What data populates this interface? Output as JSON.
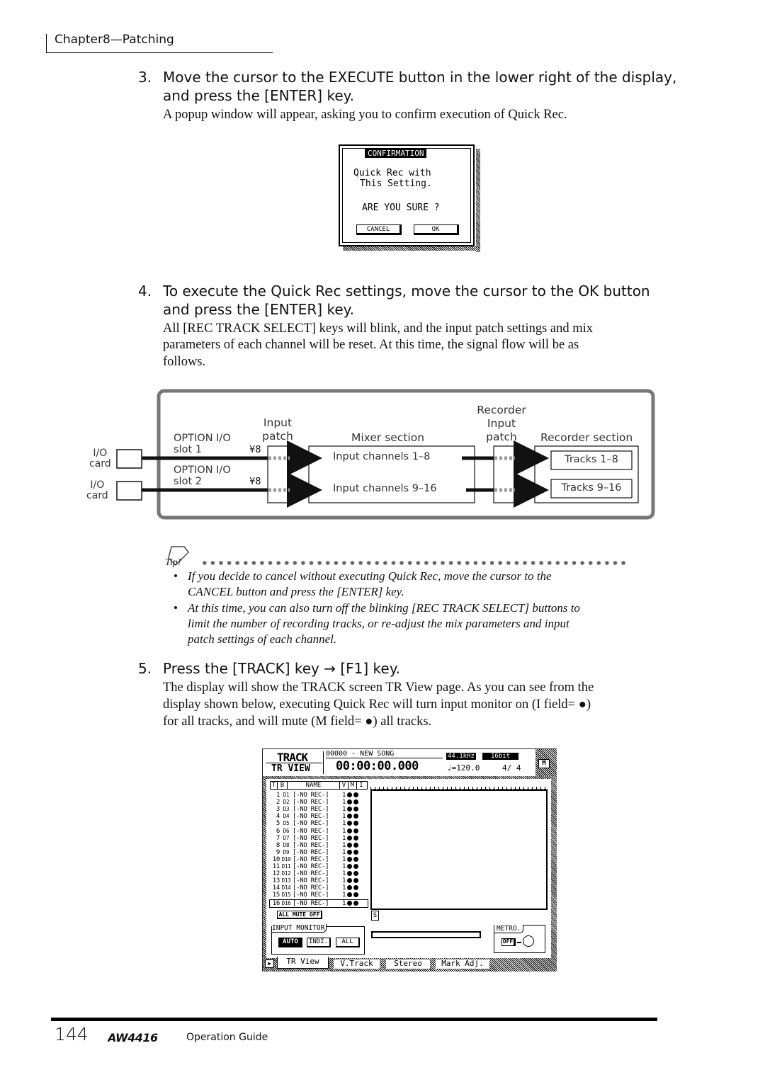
{
  "header": {
    "chapter": "Chapter8—Patching"
  },
  "step3": {
    "num": "3.",
    "line1": "Move the cursor to the EXECUTE button in the lower right of the display,",
    "line2": "and press the [ENTER] key.",
    "body": "A popup window will appear, asking you to confirm execution of Quick Rec."
  },
  "confirm": {
    "title": "CONFIRMATION",
    "line1": "Quick Rec with",
    "line2": "This Setting.",
    "question": "ARE YOU SURE ?",
    "cancel": "CANCEL",
    "ok": "OK"
  },
  "step4": {
    "num": "4.",
    "line1": "To execute the Quick Rec settings, move the cursor to the OK button",
    "line2": "and press the [ENTER] key.",
    "body": [
      "All [REC TRACK SELECT] keys will blink, and the input patch settings and mix",
      "parameters of each channel will be reset. At this time, the signal flow will be as",
      "follows."
    ]
  },
  "diagram": {
    "io_card": [
      "I/O",
      "card"
    ],
    "slot1": [
      "OPTION I/O",
      "slot 1"
    ],
    "slot2": [
      "OPTION I/O",
      "slot 2"
    ],
    "mult": "¥8",
    "input_patch": [
      "Input",
      "patch"
    ],
    "mixer": "Mixer section",
    "ch1": "Input channels 1–8",
    "ch2": "Input channels 9–16",
    "rec_patch": [
      "Recorder",
      "Input",
      "patch"
    ],
    "recorder": "Recorder section",
    "tr1": "Tracks 1–8",
    "tr2": "Tracks 9–16"
  },
  "tip": {
    "label": "Tip!",
    "bullets": [
      [
        "If you decide to cancel without executing Quick Rec, move the cursor to the",
        "CANCEL button and press the [ENTER] key."
      ],
      [
        "At this time, you can also turn off the blinking [REC TRACK SELECT] buttons to",
        "limit the number of recording tracks, or re-adjust the mix parameters and input",
        "patch settings of each channel."
      ]
    ]
  },
  "step5": {
    "num": "5.",
    "line1": "Press the [TRACK] key → [F1] key.",
    "body": [
      "The display will show the TRACK screen TR View page. As you can see from the",
      "display shown below, executing Quick Rec will turn input monitor on (I field= ●)",
      "for all tracks, and will mute (M field= ●) all tracks."
    ]
  },
  "track_screen": {
    "title": "TRACK",
    "page": "TR VIEW",
    "song": "00000 - NEW SONG",
    "rate": "44.1kHz",
    "bits": "16bit",
    "time": "00:00:00.000",
    "tempo": "♩=120.0",
    "meter": "4/ 4",
    "m_button": "M",
    "columns": [
      "T",
      "B",
      "NAME",
      "V",
      "M",
      "I"
    ],
    "tracks": [
      {
        "t": "1",
        "b": "D1",
        "name": "[-NO REC-]",
        "v": "1"
      },
      {
        "t": "2",
        "b": "D2",
        "name": "[-NO REC-]",
        "v": "1"
      },
      {
        "t": "3",
        "b": "D3",
        "name": "[-NO REC-]",
        "v": "1"
      },
      {
        "t": "4",
        "b": "D4",
        "name": "[-NO REC-]",
        "v": "1"
      },
      {
        "t": "5",
        "b": "D5",
        "name": "[-NO REC-]",
        "v": "1"
      },
      {
        "t": "6",
        "b": "D6",
        "name": "[-NO REC-]",
        "v": "1"
      },
      {
        "t": "7",
        "b": "D7",
        "name": "[-NO REC-]",
        "v": "1"
      },
      {
        "t": "8",
        "b": "D8",
        "name": "[-NO REC-]",
        "v": "1"
      },
      {
        "t": "9",
        "b": "D9",
        "name": "[-NO REC-]",
        "v": "1"
      },
      {
        "t": "10",
        "b": "D10",
        "name": "[-NO REC-]",
        "v": "1"
      },
      {
        "t": "11",
        "b": "D11",
        "name": "[-NO REC-]",
        "v": "1"
      },
      {
        "t": "12",
        "b": "D12",
        "name": "[-NO REC-]",
        "v": "1"
      },
      {
        "t": "13",
        "b": "D13",
        "name": "[-NO REC-]",
        "v": "1"
      },
      {
        "t": "14",
        "b": "D14",
        "name": "[-NO REC-]",
        "v": "1"
      },
      {
        "t": "15",
        "b": "D15",
        "name": "[-NO REC-]",
        "v": "1"
      },
      {
        "t": "16",
        "b": "D16",
        "name": "[-NO REC-]",
        "v": "1"
      }
    ],
    "all_mute": "ALL MUTE OFF",
    "s_marker": "S",
    "input_monitor": {
      "label": "INPUT MONITOR",
      "options": [
        "AUTO",
        "INDI.",
        "ALL"
      ],
      "selected": "AUTO"
    },
    "metro": {
      "label": "METRO.",
      "value": "OFF"
    },
    "tabs": [
      "TR View",
      "V.Track",
      "Stereo",
      "Mark Adj."
    ],
    "active_tab": "TR View"
  },
  "footer": {
    "page": "144",
    "logo": "AW4416",
    "guide": "Operation Guide"
  }
}
